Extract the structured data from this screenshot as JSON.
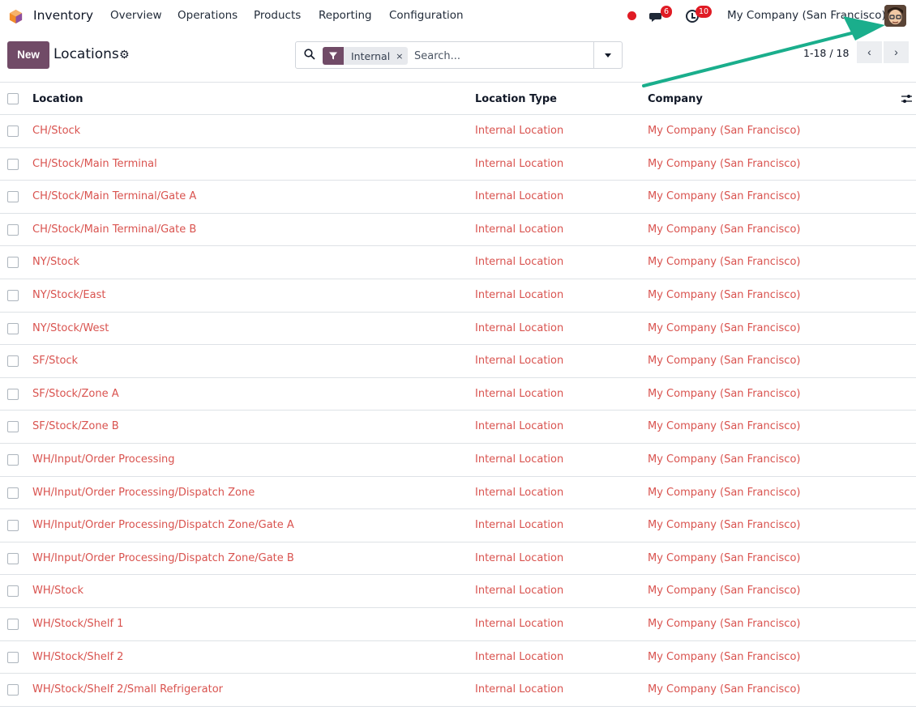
{
  "navbar": {
    "app_name": "Inventory",
    "menu": [
      "Overview",
      "Operations",
      "Products",
      "Reporting",
      "Configuration"
    ],
    "messages_count": "6",
    "activities_count": "10",
    "company": "My Company (San Francisco)",
    "icons": [
      "inventory-logo-icon",
      "chat-icon",
      "clock-icon",
      "avatar"
    ]
  },
  "control_panel": {
    "new_label": "New",
    "title": "Locations",
    "search": {
      "facet_value": "Internal",
      "facet_close": "×",
      "placeholder": "Search..."
    },
    "pager": {
      "value": "1-18 / 18",
      "prev": "‹",
      "next": "›"
    }
  },
  "table": {
    "columns": [
      "Location",
      "Location Type",
      "Company"
    ],
    "rows": [
      [
        "CH/Stock",
        "Internal Location",
        "My Company (San Francisco)"
      ],
      [
        "CH/Stock/Main Terminal",
        "Internal Location",
        "My Company (San Francisco)"
      ],
      [
        "CH/Stock/Main Terminal/Gate A",
        "Internal Location",
        "My Company (San Francisco)"
      ],
      [
        "CH/Stock/Main Terminal/Gate B",
        "Internal Location",
        "My Company (San Francisco)"
      ],
      [
        "NY/Stock",
        "Internal Location",
        "My Company (San Francisco)"
      ],
      [
        "NY/Stock/East",
        "Internal Location",
        "My Company (San Francisco)"
      ],
      [
        "NY/Stock/West",
        "Internal Location",
        "My Company (San Francisco)"
      ],
      [
        "SF/Stock",
        "Internal Location",
        "My Company (San Francisco)"
      ],
      [
        "SF/Stock/Zone A",
        "Internal Location",
        "My Company (San Francisco)"
      ],
      [
        "SF/Stock/Zone B",
        "Internal Location",
        "My Company (San Francisco)"
      ],
      [
        "WH/Input/Order Processing",
        "Internal Location",
        "My Company (San Francisco)"
      ],
      [
        "WH/Input/Order Processing/Dispatch Zone",
        "Internal Location",
        "My Company (San Francisco)"
      ],
      [
        "WH/Input/Order Processing/Dispatch Zone/Gate A",
        "Internal Location",
        "My Company (San Francisco)"
      ],
      [
        "WH/Input/Order Processing/Dispatch Zone/Gate B",
        "Internal Location",
        "My Company (San Francisco)"
      ],
      [
        "WH/Stock",
        "Internal Location",
        "My Company (San Francisco)"
      ],
      [
        "WH/Stock/Shelf 1",
        "Internal Location",
        "My Company (San Francisco)"
      ],
      [
        "WH/Stock/Shelf 2",
        "Internal Location",
        "My Company (San Francisco)"
      ],
      [
        "WH/Stock/Shelf 2/Small Refrigerator",
        "Internal Location",
        "My Company (San Francisco)"
      ]
    ]
  },
  "colors": {
    "brand": "#714b67",
    "link": "#d9534f",
    "badge": "#e01b24",
    "annotation": "#1aae8c"
  }
}
